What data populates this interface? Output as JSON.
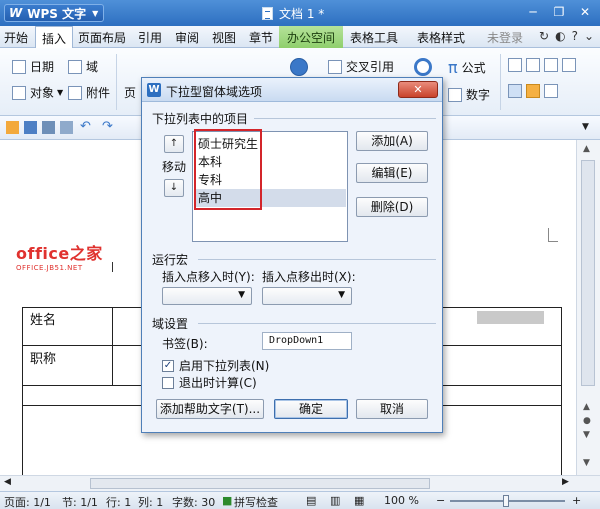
{
  "app": {
    "name": "WPS 文字",
    "doc_title": "文档 1 *"
  },
  "menu": {
    "items": [
      "开始",
      "插入",
      "页面布局",
      "引用",
      "审阅",
      "视图",
      "章节",
      "办公空间",
      "表格工具",
      "表格样式",
      "未登录"
    ],
    "active": "插入"
  },
  "ribbon": {
    "date": "日期",
    "field": "域",
    "object": "对象",
    "attachment": "附件",
    "page_partial": "页",
    "crossref": "交叉引用",
    "formula": "公式",
    "number": "数字"
  },
  "document": {
    "watermark_big": "office之家",
    "watermark_small": "OFFICE.JB51.NET",
    "cell_name": "姓名",
    "cell_title": "职称"
  },
  "status": {
    "page": "页面: 1/1",
    "section": "节: 1/1",
    "row": "行: 1",
    "col": "列: 1",
    "words": "字数: 30",
    "spellcheck": "拼写检查",
    "zoom": "100 %"
  },
  "dialog": {
    "title": "下拉型窗体域选项",
    "list_group_label": "下拉列表中的项目",
    "move_label": "移动",
    "list_items": [
      "硕士研究生",
      "本科",
      "专科",
      "高中"
    ],
    "selected_index": 3,
    "add_button": "添加(A)",
    "edit_button": "编辑(E)",
    "delete_button": "删除(D)",
    "macro_group_label": "运行宏",
    "entry_label": "插入点移入时(Y):",
    "exit_label": "插入点移出时(X):",
    "field_group_label": "域设置",
    "bookmark_label": "书签(B):",
    "bookmark_value": "DropDown1",
    "enable_dropdown_label": "启用下拉列表(N)",
    "enable_dropdown_checked": true,
    "calc_on_exit_label": "退出时计算(C)",
    "calc_on_exit_checked": false,
    "help_button": "添加帮助文字(T)...",
    "ok_button": "确定",
    "cancel_button": "取消",
    "close_icon": "close-icon"
  },
  "colors": {
    "titlebar": "#2d6fc0",
    "highlight_box": "#d3252a",
    "office_logo": "#e0322f"
  }
}
